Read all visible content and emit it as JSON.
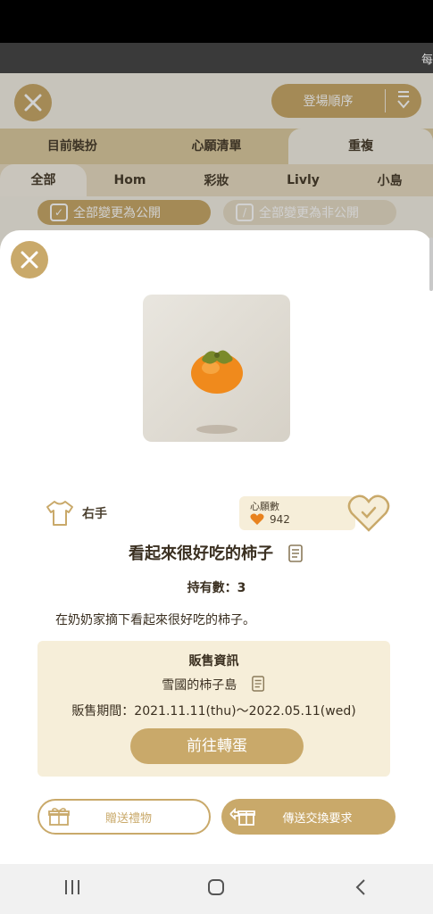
{
  "ticker": {
    "text": "每"
  },
  "background": {
    "sort_label": "登場順序",
    "tabs": [
      "目前裝扮",
      "心願清單",
      "重複"
    ],
    "categories": [
      "全部",
      "Hom",
      "彩妝",
      "Livly",
      "小島"
    ],
    "make_public_label": "全部變更為公開",
    "make_private_label": "全部變更為非公開"
  },
  "item": {
    "slot": "右手",
    "wish_title": "心願數",
    "wish_count": "942",
    "name": "看起來很好吃的柿子",
    "owned": "持有數：3",
    "description": "在奶奶家摘下看起來很好吃的柿子。"
  },
  "sales": {
    "title": "販售資訊",
    "island": "雪國的柿子島",
    "period": "販售期間：2021.11.11(thu)～2022.05.11(wed)",
    "gacha_button": "前往轉蛋"
  },
  "actions": {
    "gift_label": "贈送禮物",
    "trade_label": "傳送交換要求"
  },
  "colors": {
    "accent": "#c9a96a",
    "panel": "#f6eed9",
    "heart": "#e8821e"
  }
}
